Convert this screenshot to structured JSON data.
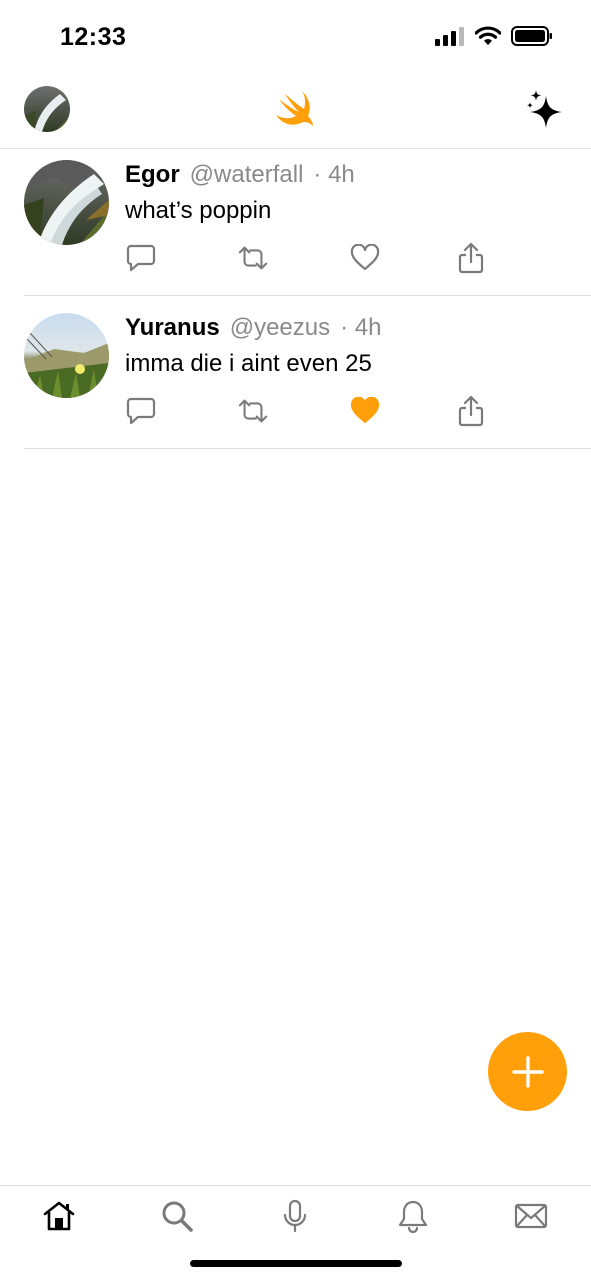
{
  "status": {
    "time": "12:33"
  },
  "header": {
    "logo_icon": "swift-bird-icon",
    "sparkle_icon": "sparkles-icon"
  },
  "colors": {
    "accent": "#ff9f0a",
    "secondary_text": "#8a8a8a",
    "divider": "#e2e2e2"
  },
  "posts": [
    {
      "name": "Egor",
      "handle": "@waterfall",
      "separator": "·",
      "time": "4h",
      "text": "what’s poppin",
      "liked": false
    },
    {
      "name": "Yuranus",
      "handle": "@yeezus",
      "separator": "·",
      "time": "4h",
      "text": "imma die i aint even 25",
      "liked": true
    }
  ],
  "tabs": [
    {
      "name": "home",
      "icon": "house-icon",
      "selected": true
    },
    {
      "name": "search",
      "icon": "magnifier-icon",
      "selected": false
    },
    {
      "name": "spaces",
      "icon": "microphone-icon",
      "selected": false
    },
    {
      "name": "notifications",
      "icon": "bell-icon",
      "selected": false
    },
    {
      "name": "messages",
      "icon": "envelope-icon",
      "selected": false
    }
  ]
}
